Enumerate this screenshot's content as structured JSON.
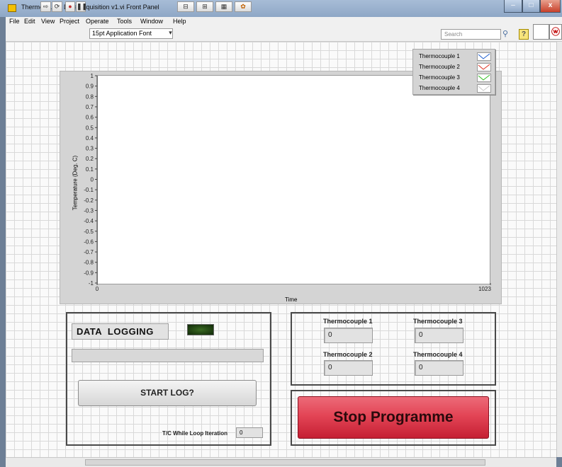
{
  "window": {
    "title": "Thermocouple Data Acquisition v1.vi Front Panel",
    "controls": {
      "minimize": "–",
      "maximize": "□",
      "close": "x"
    }
  },
  "menu": [
    "File",
    "Edit",
    "View",
    "Project",
    "Operate",
    "Tools",
    "Window",
    "Help"
  ],
  "toolbar": {
    "font_label": "15pt Application Font",
    "search_placeholder": "Search",
    "help_icon": "?"
  },
  "chart_data": {
    "type": "line",
    "ylabel": "Temperature (Deg. C)",
    "xlabel": "Time",
    "xlim": [
      0,
      1023
    ],
    "ylim": [
      -1,
      1
    ],
    "x_ticks": [
      "0",
      "1023"
    ],
    "y_ticks": [
      "1",
      "0.9",
      "0.8",
      "0.7",
      "0.6",
      "0.5",
      "0.4",
      "0.3",
      "0.2",
      "0.1",
      "0",
      "-0.1",
      "-0.2",
      "-0.3",
      "-0.4",
      "-0.5",
      "-0.6",
      "-0.7",
      "-0.8",
      "-0.9",
      "-1"
    ],
    "grid": false,
    "legend_position": "top-right",
    "series": [
      {
        "name": "Thermocouple 1",
        "color": "#1f5fd0",
        "values": []
      },
      {
        "name": "Thermocouple 2",
        "color": "#e03020",
        "values": []
      },
      {
        "name": "Thermocouple 3",
        "color": "#30c020",
        "values": []
      },
      {
        "name": "Thermocouple 4",
        "color": "#e8e8e8",
        "values": []
      }
    ]
  },
  "logging": {
    "title": "DATA  LOGGING",
    "progress": 0,
    "start_button": "START LOG?",
    "iteration_label": "T/C While Loop Iteration",
    "iteration_value": "0"
  },
  "thermocouples": [
    {
      "label": "Thermocouple 1",
      "value": "0"
    },
    {
      "label": "Thermocouple 2",
      "value": "0"
    },
    {
      "label": "Thermocouple 3",
      "value": "0"
    },
    {
      "label": "Thermocouple 4",
      "value": "0"
    }
  ],
  "stop_button": "Stop Programme",
  "colors": {
    "stop": "#e34556",
    "led_off": "#1e4510",
    "panel_grid": "#d9d9d9"
  }
}
